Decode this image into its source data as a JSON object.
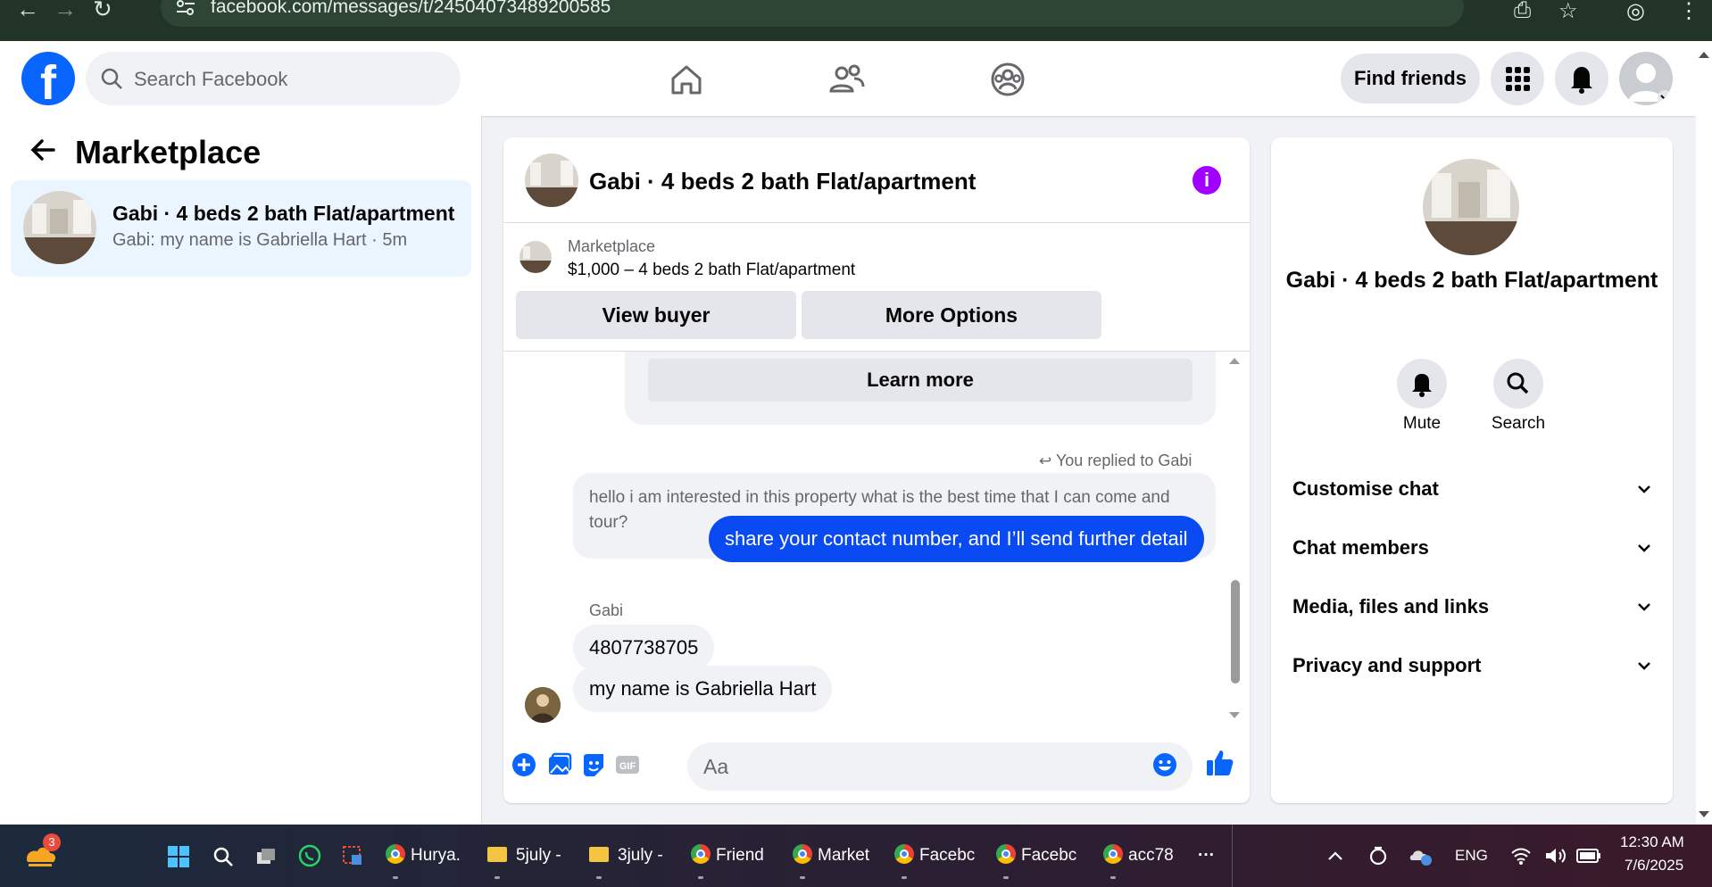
{
  "browser": {
    "url": "facebook.com/messages/t/24504073489200585"
  },
  "topnav": {
    "search_placeholder": "Search Facebook",
    "find_friends": "Find friends"
  },
  "left": {
    "title": "Marketplace",
    "conversation": {
      "title": "Gabi · 4 beds 2 bath Flat/apartment",
      "preview": "Gabi: my name is Gabriella Hart · 5m"
    }
  },
  "chat": {
    "title": "Gabi · 4 beds 2 bath Flat/apartment",
    "listing_category": "Marketplace",
    "listing_price": "$1,000 – 4 beds 2 bath Flat/apartment",
    "view_buyer": "View buyer",
    "more_options": "More Options",
    "learn_more": "Learn more",
    "replied_label": "You replied to Gabi",
    "quoted_message": "hello i am interested in this property what is the best time that I can come and tour?",
    "outgoing_message": "share your contact number, and I’ll send further detail",
    "sender_name": "Gabi",
    "incoming_messages": [
      "4807738705",
      "my name is Gabriella Hart"
    ],
    "composer_placeholder": "Aa"
  },
  "info_panel": {
    "title": "Gabi · 4 beds 2 bath Flat/apartment",
    "actions": [
      "Mute",
      "Search"
    ],
    "sections": [
      "Customise chat",
      "Chat members",
      "Media, files and links",
      "Privacy and support"
    ]
  },
  "taskbar": {
    "widget_badge": "3",
    "items": [
      "Hurya.",
      "5july -",
      "3july -",
      "Friend",
      "Market",
      "Facebc",
      "Facebc",
      "acc78"
    ],
    "more": "···",
    "language": "ENG",
    "time": "12:30 AM",
    "date": "7/6/2025"
  },
  "colors": {
    "fb_blue": "#0866ff",
    "outgoing_bubble": "#0a4af3",
    "info_purple": "#a100ff"
  }
}
